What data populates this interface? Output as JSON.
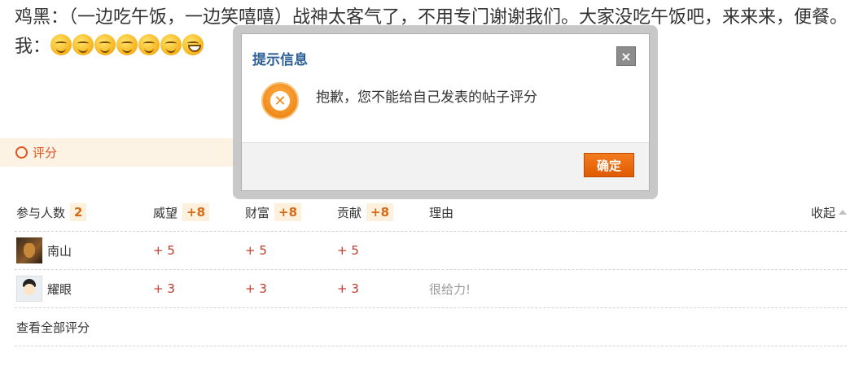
{
  "post": {
    "line1": "鸡黑：（一边吃午饭，一边笑嘻嘻）战神太客气了，不用专门谢谢我们。大家没吃午饭吧，来来来，便餐。",
    "line2_prefix": "我：",
    "emojis": [
      "titter-emoji",
      "titter-emoji",
      "titter-emoji",
      "titter-emoji",
      "titter-emoji",
      "titter-emoji",
      "grin-emoji"
    ]
  },
  "rate_tab": {
    "label": "评分"
  },
  "rate_table": {
    "headers": {
      "participants": "参与人数",
      "participants_count": "2",
      "prestige": "威望",
      "prestige_total": "+8",
      "wealth": "财富",
      "wealth_total": "+8",
      "contribution": "贡献",
      "contribution_total": "+8",
      "reason": "理由",
      "collapse": "收起"
    },
    "rows": [
      {
        "name": "南山",
        "avatar": "dog-avatar",
        "prestige": "+ 5",
        "wealth": "+ 5",
        "contribution": "+ 5",
        "reason": ""
      },
      {
        "name": "耀眼",
        "avatar": "kid-avatar",
        "prestige": "+ 3",
        "wealth": "+ 3",
        "contribution": "+ 3",
        "reason": "很给力!"
      }
    ],
    "view_all": "查看全部评分"
  },
  "dialog": {
    "title": "提示信息",
    "close_symbol": "×",
    "icon": "error-x-icon",
    "message": "抱歉，您不能给自己发表的帖子评分",
    "ok_label": "确定"
  }
}
